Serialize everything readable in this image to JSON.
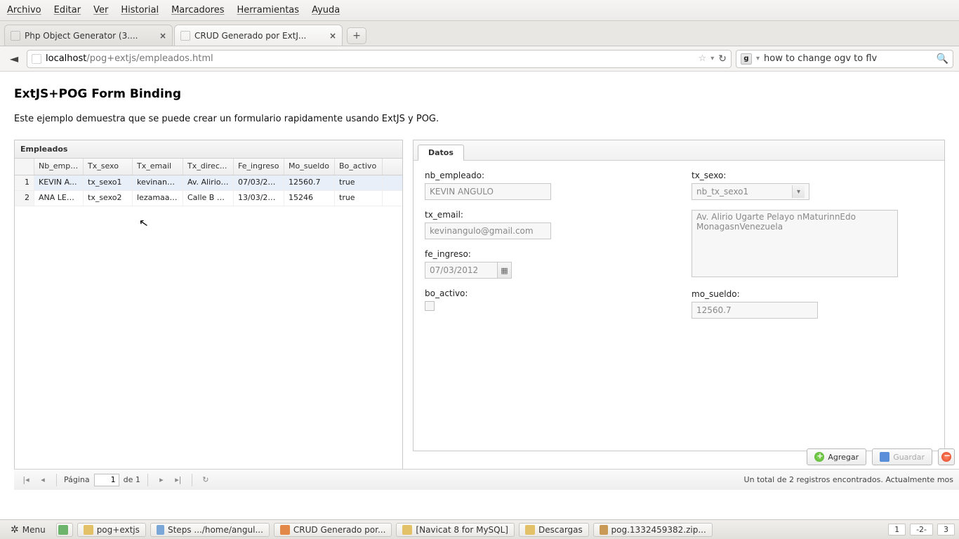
{
  "menubar": {
    "items": [
      "Archivo",
      "Editar",
      "Ver",
      "Historial",
      "Marcadores",
      "Herramientas",
      "Ayuda"
    ]
  },
  "tabs": [
    {
      "title": "Php Object Generator (3....",
      "active": false
    },
    {
      "title": "CRUD Generado por ExtJ...",
      "active": true
    }
  ],
  "newtab_label": "+",
  "url": {
    "host": "localhost",
    "path": "/pog+extjs/empleados.html"
  },
  "search": {
    "engine": "g",
    "text": "how to change ogv to flv"
  },
  "page": {
    "title": "ExtJS+POG Form Binding",
    "intro": "Este ejemplo demuestra que se puede crear un formulario rapidamente usando ExtJS y POG."
  },
  "grid": {
    "title": "Empleados",
    "columns": [
      "Nb_empl...",
      "Tx_sexo",
      "Tx_email",
      "Tx_direc...",
      "Fe_ingreso",
      "Mo_sueldo",
      "Bo_activo"
    ],
    "rows": [
      {
        "n": "1",
        "cells": [
          "KEVIN A...",
          "tx_sexo1",
          "kevinang...",
          "Av. Alirio ...",
          "07/03/2012",
          "12560.7",
          "true"
        ],
        "selected": true
      },
      {
        "n": "2",
        "cells": [
          "ANA LEZ...",
          "tx_sexo2",
          "lezamaas...",
          "Calle B C...",
          "13/03/2012",
          "15246",
          "true"
        ],
        "selected": false
      }
    ],
    "pager": {
      "label_page": "Página",
      "current": "1",
      "of": "de 1",
      "status": "Un total de 2 registros encontrados. Actualmente mos"
    }
  },
  "form": {
    "tab": "Datos",
    "fields": {
      "nb_empleado": {
        "label": "nb_empleado:",
        "value": "KEVIN ANGULO"
      },
      "tx_sexo": {
        "label": "tx_sexo:",
        "value": "nb_tx_sexo1"
      },
      "tx_email": {
        "label": "tx_email:",
        "value": "kevinangulo@gmail.com"
      },
      "direccion": {
        "value": "Av. Alirio Ugarte Pelayo nMaturinnEdo MonagasnVenezuela"
      },
      "fe_ingreso": {
        "label": "fe_ingreso:",
        "value": "07/03/2012"
      },
      "bo_activo": {
        "label": "bo_activo:"
      },
      "mo_sueldo": {
        "label": "mo_sueldo:",
        "value": "12560.7"
      }
    },
    "buttons": {
      "agregar": "Agregar",
      "guardar": "Guardar"
    }
  },
  "taskbar": {
    "menu": "Menu",
    "items": [
      "pog+extjs",
      "Steps .../home/angul...",
      "CRUD Generado por...",
      "[Navicat 8 for MySQL]",
      "Descargas",
      "pog.1332459382.zip..."
    ],
    "workspaces": [
      "1",
      "-2-",
      "3"
    ]
  }
}
